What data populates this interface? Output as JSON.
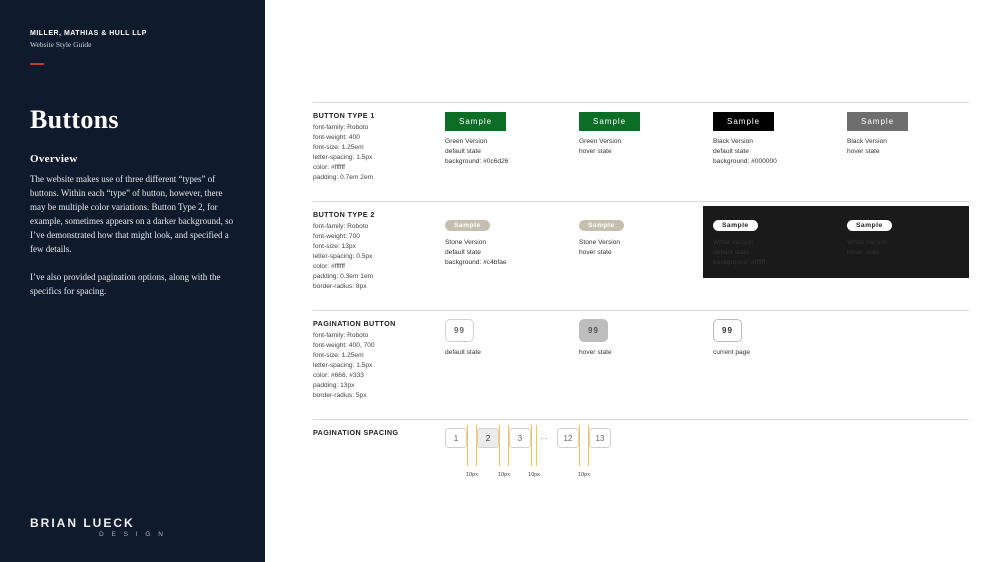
{
  "sidebar": {
    "client": "MILLER, MATHIAS & HULL LLP",
    "guide": "Website Style Guide",
    "title": "Buttons",
    "overview_heading": "Overview",
    "overview_p1": "The website makes use of three different “types” of buttons. Within each “type” of button, however, there may be multiple color variations. Button Type 2, for example, sometimes appears on a darker background, so I’ve demonstrated how that might look, and specified a few details.",
    "overview_p2": "I’ve also provided pagination options, along with the specifics for spacing.",
    "footer_name": "BRIAN LUECK",
    "footer_sub": "D E S I G N"
  },
  "btn_type1": {
    "title": "BUTTON TYPE 1",
    "specs": "font-family: Roboto\nfont-weight: 400\nfont-size: 1.25em\nletter-spacing: 1.5px\ncolor: #ffffff\npadding: 0.7em 2em",
    "cols": [
      {
        "label": "Sample",
        "cap": "Green Version\ndefault state\nbackground: #0c6d26",
        "style": "green"
      },
      {
        "label": "Sample",
        "cap": "Green Version\nhover state",
        "style": "green"
      },
      {
        "label": "Sample",
        "cap": "Black Version\ndefault state\nbackground: #000000",
        "style": "black"
      },
      {
        "label": "Sample",
        "cap": "Black Version\nhover state",
        "style": "blackhover"
      }
    ]
  },
  "btn_type2": {
    "title": "BUTTON TYPE 2",
    "specs": "font-family: Roboto\nfont-weight: 700\nfont-size: 13px\nletter-spacing: 0.5px\ncolor: #ffffff\npadding: 0.3em 1em\nborder-radius: 8px",
    "light": [
      {
        "label": "Sample",
        "cap": "Stone Version\ndefault state\nbackground: #c4bfae"
      },
      {
        "label": "Sample",
        "cap": "Stone Version\nhover state"
      }
    ],
    "dark": [
      {
        "label": "Sample",
        "cap": "White Version\ndefault state\nbackground: #ffffff"
      },
      {
        "label": "Sample",
        "cap": "White Version\nhover state"
      }
    ]
  },
  "pagination": {
    "title": "PAGINATION BUTTON",
    "specs": "font-family: Roboto\nfont-weight: 400, 700\nfont-size: 1.25em\nletter-spacing: 1.5px\ncolor: #666, #333\npadding: 13px\nborder-radius: 5px",
    "items": [
      {
        "value": "99",
        "cap": "default state"
      },
      {
        "value": "99",
        "cap": "hover state"
      },
      {
        "value": "99",
        "cap": "current page"
      }
    ]
  },
  "spacing": {
    "title": "PAGINATION SPACING",
    "pages": [
      "1",
      "2",
      "3",
      "…",
      "12",
      "13"
    ],
    "gap_labels": [
      "10px",
      "10px",
      "10px",
      "10px"
    ]
  }
}
